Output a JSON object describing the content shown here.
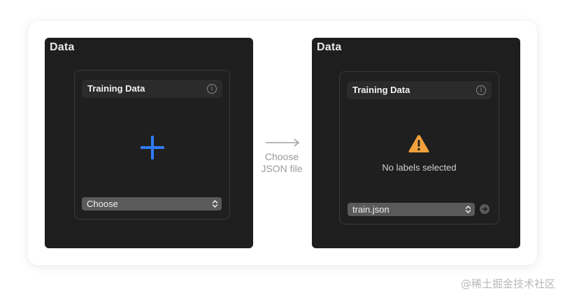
{
  "left_panel": {
    "title": "Data",
    "box_title": "Training Data",
    "popup_value": "Choose"
  },
  "transition": {
    "caption_line1": "Choose",
    "caption_line2": "JSON file"
  },
  "right_panel": {
    "title": "Data",
    "box_title": "Training Data",
    "empty_message": "No labels selected",
    "popup_value": "train.json"
  },
  "watermark": "@稀土掘金技术社区",
  "colors": {
    "panel_bg": "#1e1e1e",
    "accent_blue": "#2f7bf5",
    "warning_orange": "#f0a03c"
  },
  "icons": {
    "add": "plus-icon",
    "info": "info-icon",
    "warning": "warning-icon",
    "popup": "chevron-updown-icon",
    "go": "arrow-circle-right-icon",
    "transition": "arrow-right-icon"
  }
}
